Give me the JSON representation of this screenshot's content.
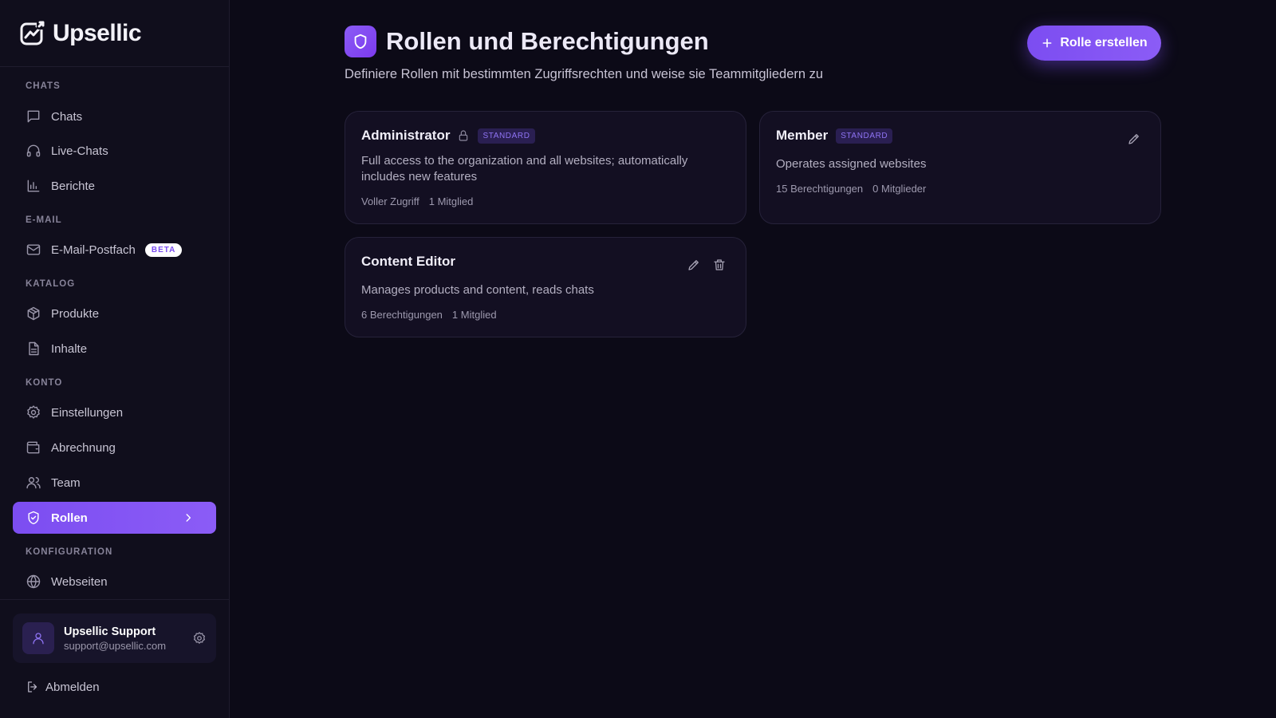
{
  "brand": {
    "name": "Upsellic"
  },
  "sidebar": {
    "sections": [
      {
        "label": "CHATS"
      },
      {
        "label": "E-MAIL"
      },
      {
        "label": "KATALOG"
      },
      {
        "label": "KONTO"
      },
      {
        "label": "KONFIGURATION"
      }
    ],
    "items": [
      {
        "label": "Chats",
        "icon": "message-square-icon"
      },
      {
        "label": "Live-Chats",
        "icon": "headphones-icon"
      },
      {
        "label": "Berichte",
        "icon": "bar-chart-icon"
      },
      {
        "label": "E-Mail-Postfach",
        "icon": "mail-icon",
        "badge": "BETA"
      },
      {
        "label": "Produkte",
        "icon": "package-icon"
      },
      {
        "label": "Inhalte",
        "icon": "file-text-icon"
      },
      {
        "label": "Einstellungen",
        "icon": "gear-icon"
      },
      {
        "label": "Abrechnung",
        "icon": "wallet-icon"
      },
      {
        "label": "Team",
        "icon": "users-icon"
      },
      {
        "label": "Rollen",
        "icon": "shield-check-icon",
        "active": true
      },
      {
        "label": "Webseiten",
        "icon": "globe-icon"
      }
    ],
    "user": {
      "name": "Upsellic Support",
      "email": "support@upsellic.com"
    },
    "logout_label": "Abmelden"
  },
  "header": {
    "title": "Rollen und Berechtigungen",
    "subtitle": "Definiere Rollen mit bestimmten Zugriffsrechten und weise sie Teammitgliedern zu",
    "create_button_label": "Rolle erstellen"
  },
  "roles": [
    {
      "name": "Administrator",
      "locked": true,
      "badge": "STANDARD",
      "description": "Full access to the organization and all websites; automatically includes new features",
      "permissions": "Voller Zugriff",
      "members": "1 Mitglied"
    },
    {
      "name": "Member",
      "badge": "STANDARD",
      "description": "Operates assigned websites",
      "permissions": "15 Berechtigungen",
      "members": "0 Mitglieder"
    },
    {
      "name": "Content Editor",
      "description": "Manages products and content, reads chats",
      "permissions": "6 Berechtigungen",
      "members": "1 Mitglied"
    }
  ],
  "colors": {
    "accent": "#8b5cf6",
    "background": "#0c0a17",
    "sidebar": "#100e1c",
    "card": "#130f22"
  }
}
